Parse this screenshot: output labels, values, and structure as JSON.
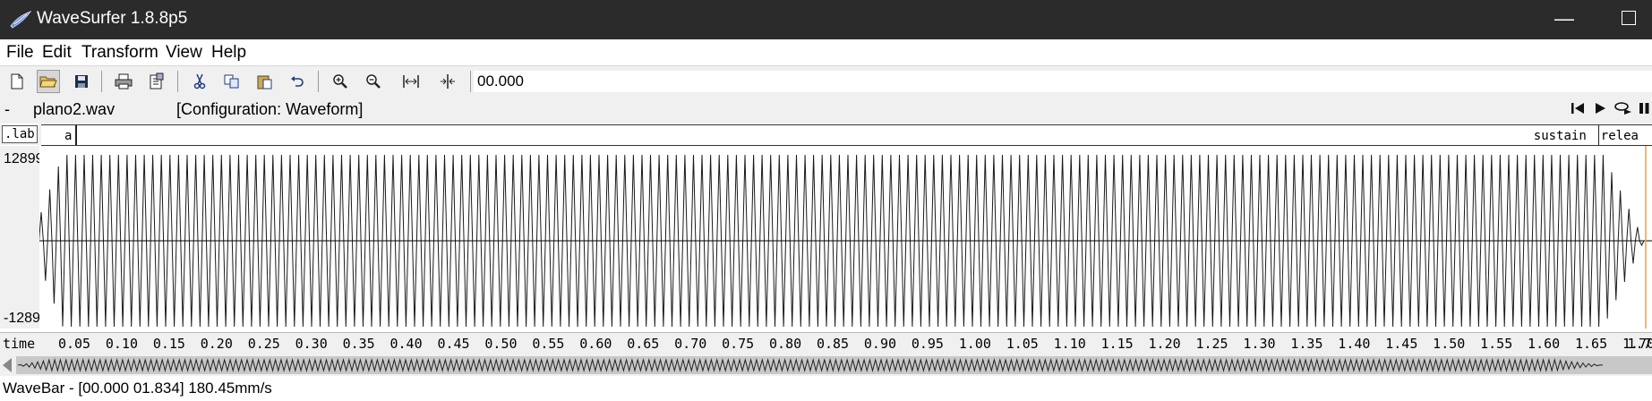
{
  "window": {
    "title": "WaveSurfer 1.8.8p5"
  },
  "menu": [
    "File",
    "Edit",
    "Transform",
    "View",
    "Help"
  ],
  "toolbar": {
    "icons": [
      "new-file-icon",
      "open-folder-icon",
      "save-icon",
      "print-icon",
      "properties-icon",
      "cut-icon",
      "copy-icon",
      "paste-icon",
      "undo-icon",
      "zoom-in-icon",
      "zoom-out-icon",
      "zoom-fit-icon",
      "zoom-selection-icon"
    ],
    "time_value": "00.000"
  },
  "file_bar": {
    "dash": "-",
    "file_name": "plano2.wav",
    "configuration": "[Configuration: Waveform]"
  },
  "playback_controls": [
    "skip-to-start-icon",
    "play-icon",
    "loop-play-icon",
    "pause-icon"
  ],
  "label_pane": {
    "button_label": ".lab",
    "segments": [
      {
        "label": "a",
        "start": 0.0
      },
      {
        "label": "sustain",
        "end": 1.6573
      },
      {
        "label": "relea",
        "start": 1.6573
      }
    ]
  },
  "waveform": {
    "amplitude_max_label": "12899",
    "amplitude_min_label": "-1289",
    "cursor_time": 1.7075,
    "colors": {
      "wave": "#1a1a1a",
      "cursor": "#f0a030",
      "background": "#ffffff"
    }
  },
  "time_axis": {
    "label": "time",
    "ticks": [
      "0.05",
      "0.10",
      "0.15",
      "0.20",
      "0.25",
      "0.30",
      "0.35",
      "0.40",
      "0.45",
      "0.50",
      "0.55",
      "0.60",
      "0.65",
      "0.70",
      "0.75",
      "0.80",
      "0.85",
      "0.90",
      "0.95",
      "1.00",
      "1.05",
      "1.10",
      "1.15",
      "1.20",
      "1.25",
      "1.30",
      "1.35",
      "1.40",
      "1.45",
      "1.50",
      "1.55",
      "1.60",
      "1.65",
      "1.70",
      "1.7"
    ]
  },
  "status": {
    "text": "WaveBar - [00.000 01.834] 180.45mm/s"
  }
}
